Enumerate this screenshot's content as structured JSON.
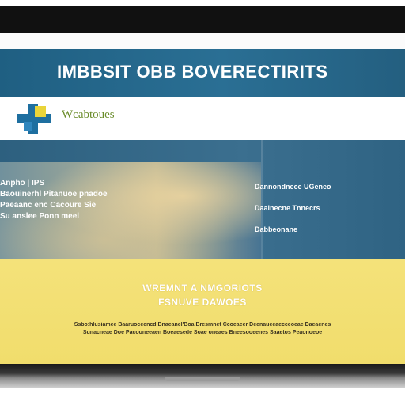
{
  "header": {
    "title": "IMBBSIT OBB BOVERECTIRITS"
  },
  "logo": {
    "text": "Wcabtoues"
  },
  "panel": {
    "left_lines": [
      "Anpho | IPS",
      "Baouinerhl Pitanuoe pnadoe",
      "Paeaanc enc Cacoure Sie",
      "Su anslee Ponn meel"
    ],
    "right_lines": [
      "Dannondnece UGeneo",
      "Daainecne Tnnecrs",
      "Dabbeonane"
    ]
  },
  "promo": {
    "heading_1": "WREMNT A NMGORIOTS",
    "heading_2": "FSNUVE DAWOES",
    "fine_print_1": "Ssbo:hlusiamee Baaruoceencd Bnaeanel'Boa Bresmnet Ccoeaeer Deenaueeaecceoeae Daeaenes",
    "fine_print_2": "Sunacneae Doe Pacouneeaen Boeaesede Soae oneaes Bneesooeenes Saaetos Peaonoeoe"
  },
  "colors": {
    "header_band": "#2a6f94",
    "panel": "#3b6f8f",
    "yellow": "#f1dd6c",
    "logo_text": "#6a8c2a"
  }
}
